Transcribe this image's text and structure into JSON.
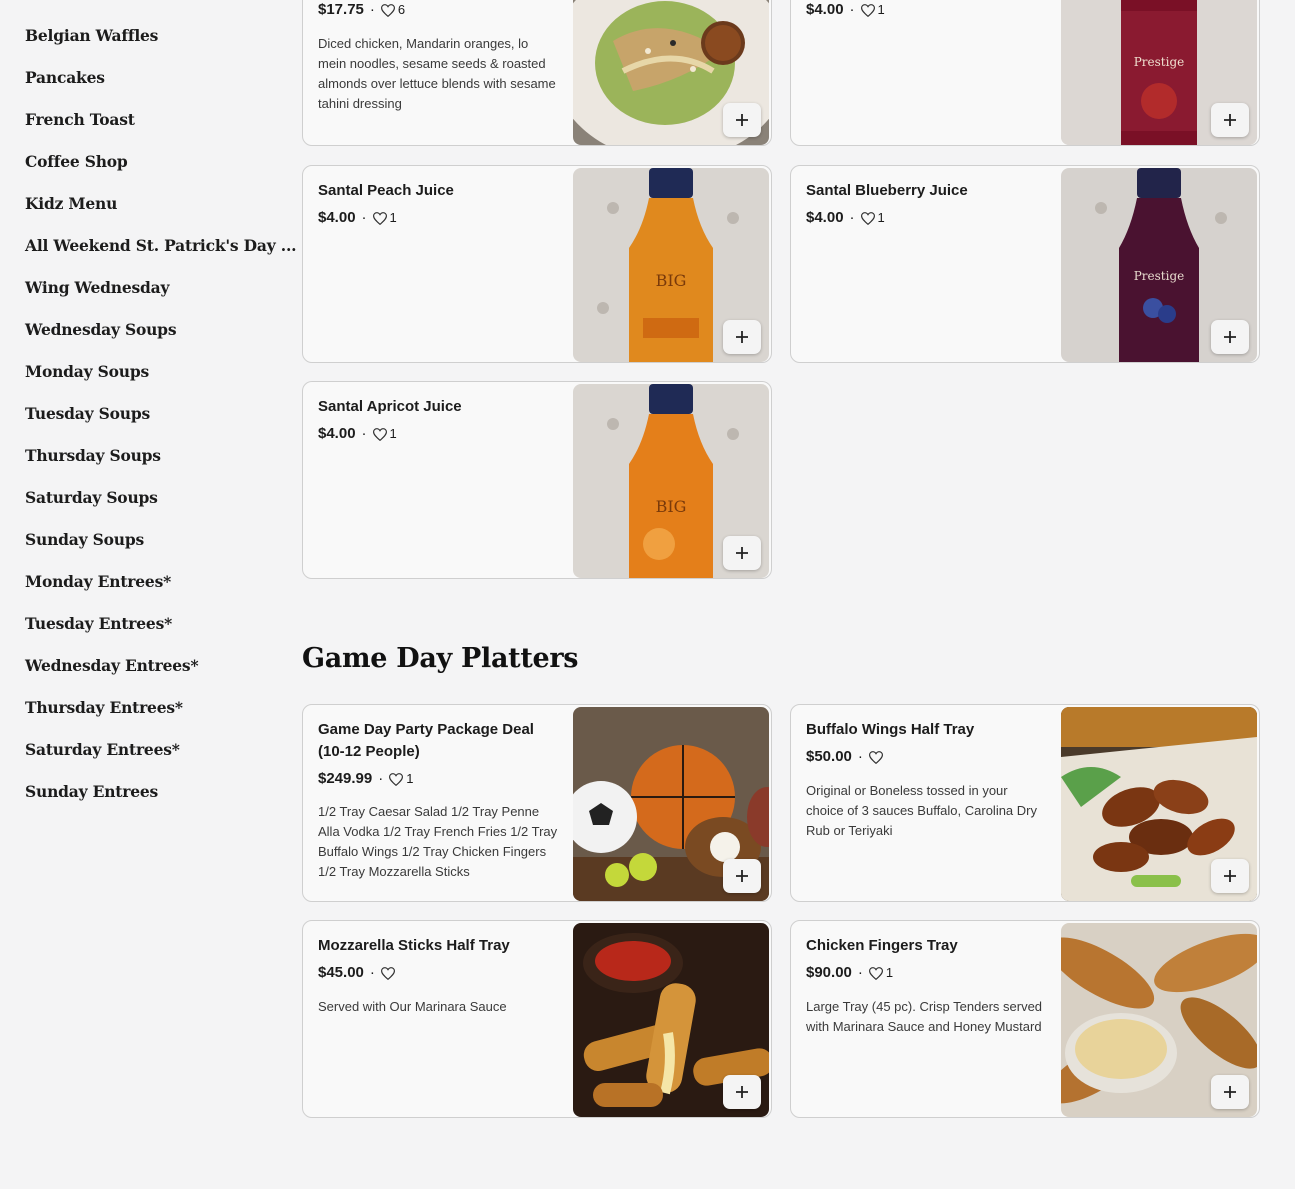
{
  "sidebar": {
    "categories": [
      "Belgian Waffles",
      "Pancakes",
      "French Toast",
      "Coffee Shop",
      "Kidz Menu",
      "All Weekend St. Patrick's Day ...",
      "Wing Wednesday",
      "Wednesday Soups",
      "Monday Soups",
      "Tuesday Soups",
      "Thursday Soups",
      "Saturday Soups",
      "Sunday Soups",
      "Monday Entrees*",
      "Tuesday Entrees*",
      "Wednesday Entrees*",
      "Thursday Entrees*",
      "Saturday Entrees*",
      "Sunday Entrees"
    ]
  },
  "items_top": [
    {
      "price": "$17.75",
      "likes": "6",
      "desc": "Diced chicken, Mandarin oranges, lo mein noodles, sesame seeds & roasted almonds over lettuce blends with sesame tahini dressing",
      "image": "salad-photo"
    },
    {
      "price": "$4.00",
      "likes": "1",
      "desc": "",
      "image": "pomegranate-juice-photo"
    },
    {
      "name": "Santal Peach Juice",
      "price": "$4.00",
      "likes": "1",
      "desc": "",
      "image": "peach-juice-photo"
    },
    {
      "name": "Santal Blueberry Juice",
      "price": "$4.00",
      "likes": "1",
      "desc": "",
      "image": "blueberry-juice-photo"
    },
    {
      "name": "Santal Apricot Juice",
      "price": "$4.00",
      "likes": "1",
      "desc": "",
      "image": "apricot-juice-photo"
    }
  ],
  "game_day": {
    "title": "Game Day Platters",
    "items": [
      {
        "name": "Game Day Party Package Deal (10-12 People)",
        "price": "$249.99",
        "likes": "1",
        "desc": "1/2 Tray Caesar Salad 1/2 Tray Penne Alla Vodka 1/2 Tray French Fries 1/2 Tray Buffalo Wings 1/2 Tray Chicken Fingers 1/2 Tray Mozzarella Sticks",
        "image": "sports-balls-photo"
      },
      {
        "name": "Buffalo Wings Half Tray",
        "price": "$50.00",
        "likes": "",
        "desc": "Original or Boneless tossed in your choice of 3 sauces Buffalo, Carolina Dry Rub or Teriyaki",
        "image": "wings-photo"
      },
      {
        "name": "Mozzarella Sticks Half Tray",
        "price": "$45.00",
        "likes": "",
        "desc": "Served with Our Marinara Sauce",
        "image": "mozzarella-sticks-photo"
      },
      {
        "name": "Chicken Fingers Tray",
        "price": "$90.00",
        "likes": "1",
        "desc": "Large Tray (45 pc). Crisp Tenders served with Marinara Sauce and Honey Mustard",
        "image": "chicken-fingers-photo"
      }
    ]
  },
  "icons": {
    "heart": "heart-icon",
    "add": "plus-icon"
  },
  "colors": {
    "background": "#f4f4f5",
    "card": "#f9f9f9",
    "border": "#cfcfcf",
    "text": "#1c1c1c"
  }
}
